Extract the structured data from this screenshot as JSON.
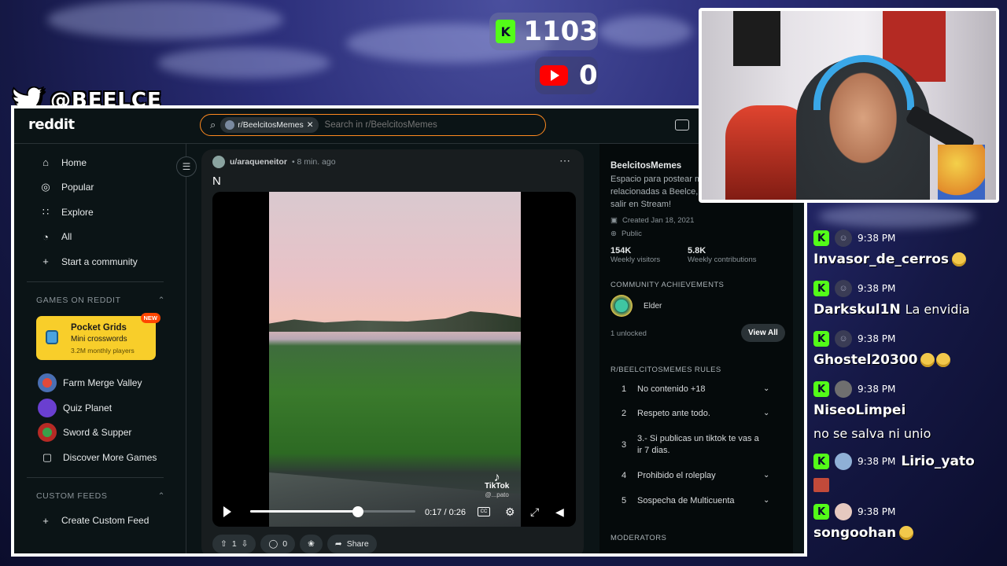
{
  "overlay": {
    "twitter_handle": "@BEELCE_",
    "kick_count": "1103",
    "youtube_count": "0"
  },
  "reddit": {
    "logo": "reddit",
    "search": {
      "chip": "r/BeelcitosMemes",
      "placeholder": "Search in r/BeelcitosMemes"
    },
    "nav": {
      "items": [
        "Home",
        "Popular",
        "Explore",
        "All",
        "Start a community"
      ],
      "icons": [
        "home-icon",
        "popular-icon",
        "explore-icon",
        "all-icon",
        "plus-icon"
      ]
    },
    "games": {
      "heading": "GAMES ON REDDIT",
      "promo": {
        "title": "Pocket Grids",
        "subtitle": "Mini crosswords",
        "players": "3.2M monthly players",
        "badge": "NEW"
      },
      "items": [
        "Farm Merge Valley",
        "Quiz Planet",
        "Sword & Supper",
        "Discover More Games"
      ]
    },
    "custom_feeds": {
      "heading": "CUSTOM FEEDS",
      "create": "Create Custom Feed"
    },
    "post": {
      "user": "u/araqueneitor",
      "time": "• 8 min. ago",
      "title": "N",
      "video": {
        "time": "0:17 / 0:26",
        "progress": 0.65,
        "watermark": "TikTok",
        "watermark_handle": "@...pato"
      },
      "votes": "1",
      "comments": "0",
      "share": "Share"
    },
    "community": {
      "name": "BeelcitosMemes",
      "description": "Espacio para postear me... relacionadas a Beelce, lo... salir en Stream!",
      "created": "Created Jan 18, 2021",
      "visibility": "Public",
      "weekly_visitors": "154K",
      "weekly_visitors_label": "Weekly visitors",
      "weekly_contributions": "5.8K",
      "weekly_contributions_label": "Weekly contributions",
      "achievements_heading": "COMMUNITY ACHIEVEMENTS",
      "achievement": "Elder",
      "unlocked": "1 unlocked",
      "view_all": "View All",
      "rules_heading": "R/BEELCITOSMEMES RULES",
      "rules": [
        {
          "n": "1",
          "text": "No contenido +18"
        },
        {
          "n": "2",
          "text": "Respeto ante todo."
        },
        {
          "n": "3",
          "text": "3.- Si publicas un tiktok te vas a ir 7 dias."
        },
        {
          "n": "4",
          "text": "Prohibido el roleplay"
        },
        {
          "n": "5",
          "text": "Sospecha de Multicuenta"
        }
      ],
      "moderators_heading": "MODERATORS"
    }
  },
  "chat": [
    {
      "time": "9:38 PM",
      "user": "Invasor_de_cerros",
      "text": ""
    },
    {
      "time": "9:38 PM",
      "user": "Darkskul1N",
      "text": "La envidia"
    },
    {
      "time": "9:38 PM",
      "user": "Ghostel20300",
      "text": ""
    },
    {
      "time": "9:38 PM",
      "user": "NiseoLimpei",
      "text": "no se salva ni unio"
    },
    {
      "time": "9:38 PM",
      "user": "Lirio_yato",
      "text": ""
    },
    {
      "time": "9:38 PM",
      "user": "songoohan",
      "text": ""
    }
  ],
  "colors": {
    "kick_green": "#53fc18",
    "reddit_bg": "#0b1416",
    "search_border": "#ff8a1f",
    "promo_yellow": "#f8ce2a",
    "youtube_red": "#ff0000"
  }
}
